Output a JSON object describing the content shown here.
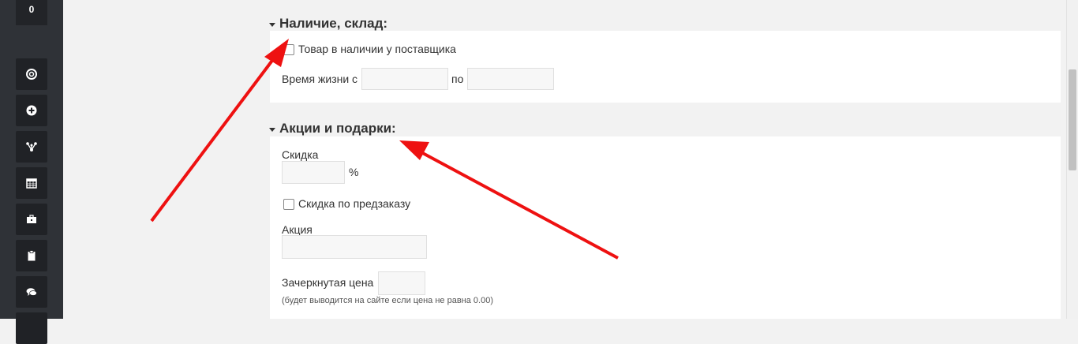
{
  "sidebar": {
    "counter": "0",
    "items": [
      {
        "icon": "lifebuoy-icon"
      },
      {
        "icon": "plus-circle-icon"
      },
      {
        "icon": "sitemap-icon"
      },
      {
        "icon": "calendar-icon"
      },
      {
        "icon": "briefcase-icon"
      },
      {
        "icon": "clipboard-icon"
      },
      {
        "icon": "comments-icon"
      }
    ]
  },
  "stock_section": {
    "title": "Наличие, склад:",
    "in_stock_checkbox_label": "Товар в наличии у поставщика",
    "lifetime_label": "Время жизни с",
    "lifetime_to_label": "по",
    "lifetime_from_value": "",
    "lifetime_to_value": ""
  },
  "promo_section": {
    "title": "Акции и подарки:",
    "discount_label": "Скидка",
    "discount_value": "",
    "discount_unit": "%",
    "preorder_discount_label": "Скидка по предзаказу",
    "promo_label": "Акция",
    "promo_value": "",
    "old_price_label": "Зачеркнутая цена",
    "old_price_value": "",
    "old_price_hint": "(будет выводится на сайте если цена не равна 0.00)"
  },
  "colors": {
    "sidebar_bg": "#2f3237",
    "button_bg": "#202226",
    "page_bg": "#f2f2f2",
    "annotation_arrow": "#ee1111"
  }
}
